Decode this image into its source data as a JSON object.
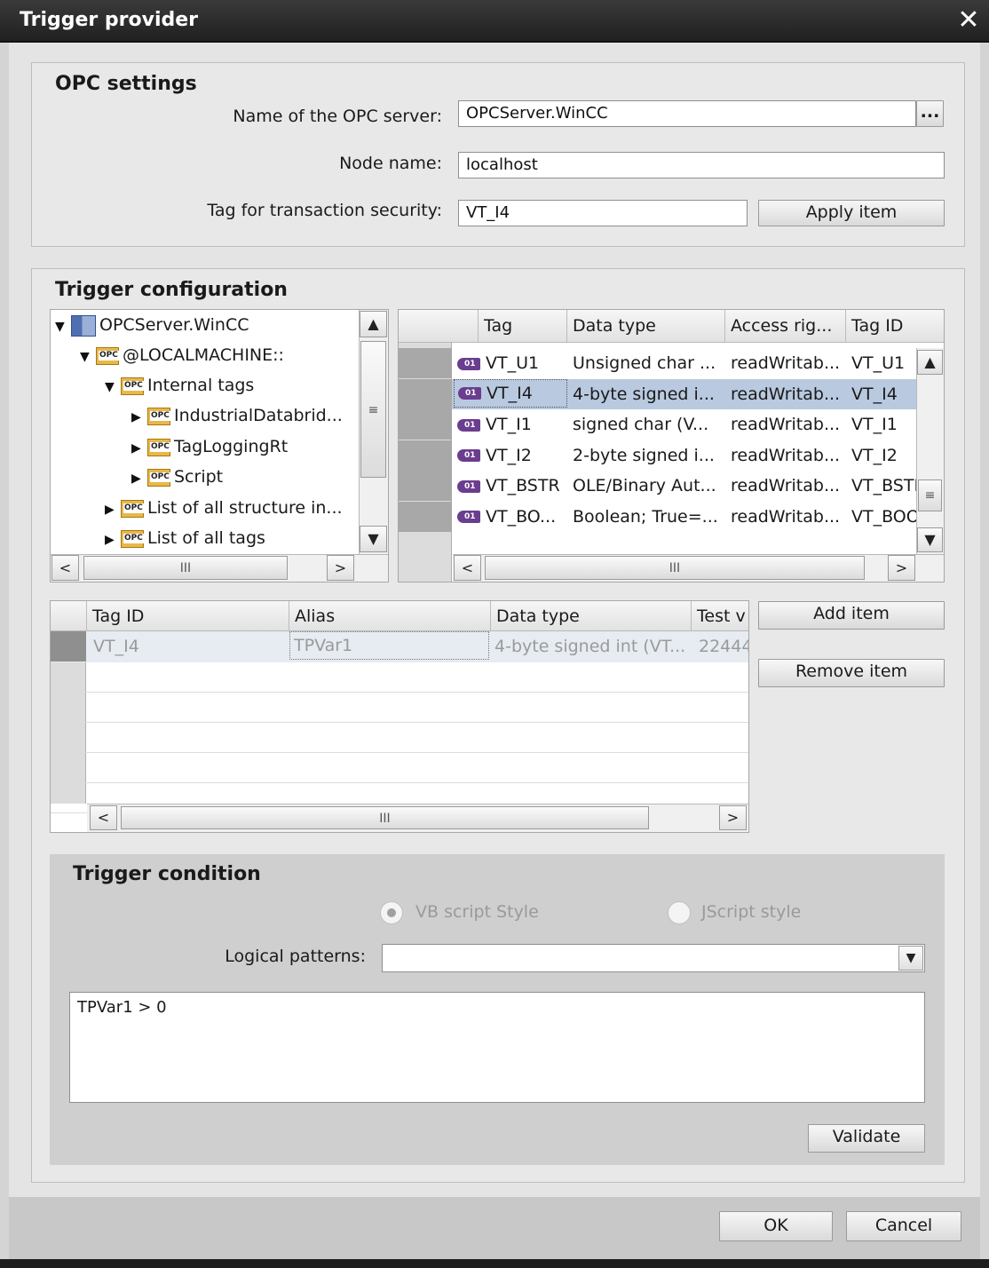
{
  "window": {
    "title": "Trigger provider",
    "close_label": "✕"
  },
  "opc_settings": {
    "heading": "OPC settings",
    "server_label": "Name of the OPC server:",
    "server_value": "OPCServer.WinCC",
    "browse_label": "...",
    "node_label": "Node name:",
    "node_value": "localhost",
    "tag_label": "Tag for transaction security:",
    "tag_value": "VT_I4",
    "apply_label": "Apply item"
  },
  "trigger_config": {
    "heading": "Trigger configuration",
    "tree": [
      {
        "label": "OPCServer.WinCC",
        "icon": "server-icon",
        "expanded": true,
        "level": 0
      },
      {
        "label": "@LOCALMACHINE::",
        "icon": "opc-folder-icon",
        "expanded": true,
        "level": 1
      },
      {
        "label": "Internal tags",
        "icon": "opc-folder-icon",
        "expanded": true,
        "level": 2
      },
      {
        "label": "IndustrialDatabrid...",
        "icon": "opc-folder-icon",
        "expanded": false,
        "level": 3
      },
      {
        "label": "TagLoggingRt",
        "icon": "opc-folder-icon",
        "expanded": false,
        "level": 3
      },
      {
        "label": "Script",
        "icon": "opc-folder-icon",
        "expanded": false,
        "level": 3
      },
      {
        "label": "List of all structure in...",
        "icon": "opc-folder-icon",
        "expanded": false,
        "level": 2
      },
      {
        "label": "List of all tags",
        "icon": "opc-folder-icon",
        "expanded": false,
        "level": 2
      }
    ],
    "tag_grid": {
      "columns": [
        "Tag",
        "Data type",
        "Access rig...",
        "Tag ID"
      ],
      "rows": [
        {
          "tag": "VT_U1",
          "type": "Unsigned char ...",
          "access": "readWritab...",
          "id": "VT_U1"
        },
        {
          "tag": "VT_I4",
          "type": "4-byte signed i...",
          "access": "readWritab...",
          "id": "VT_I4"
        },
        {
          "tag": "VT_I1",
          "type": "signed char (V...",
          "access": "readWritab...",
          "id": "VT_I1"
        },
        {
          "tag": "VT_I2",
          "type": "2-byte signed i...",
          "access": "readWritab...",
          "id": "VT_I2"
        },
        {
          "tag": "VT_BSTR",
          "type": "OLE/Binary Aut...",
          "access": "readWritab...",
          "id": "VT_BSTR"
        },
        {
          "tag": "VT_BO...",
          "type": "Boolean; True=...",
          "access": "readWritab...",
          "id": "VT_BOO"
        }
      ],
      "selected_row": 1
    },
    "item_grid": {
      "columns": [
        "Tag ID",
        "Alias",
        "Data type",
        "Test v"
      ],
      "rows": [
        {
          "id": "VT_I4",
          "alias": "TPVar1",
          "type": "4-byte signed int (VT...",
          "test": "22444"
        }
      ]
    },
    "add_label": "Add item",
    "remove_label": "Remove item"
  },
  "trigger_condition": {
    "heading": "Trigger condition",
    "vb_label": "VB script Style",
    "js_label": "JScript style",
    "patterns_label": "Logical patterns:",
    "patterns_value": "",
    "expression": "TPVar1 > 0",
    "validate_label": "Validate"
  },
  "footer": {
    "ok_label": "OK",
    "cancel_label": "Cancel"
  },
  "scrollbar": {
    "left": "<",
    "right": ">",
    "up": "^",
    "down": "v",
    "grip": "III"
  }
}
